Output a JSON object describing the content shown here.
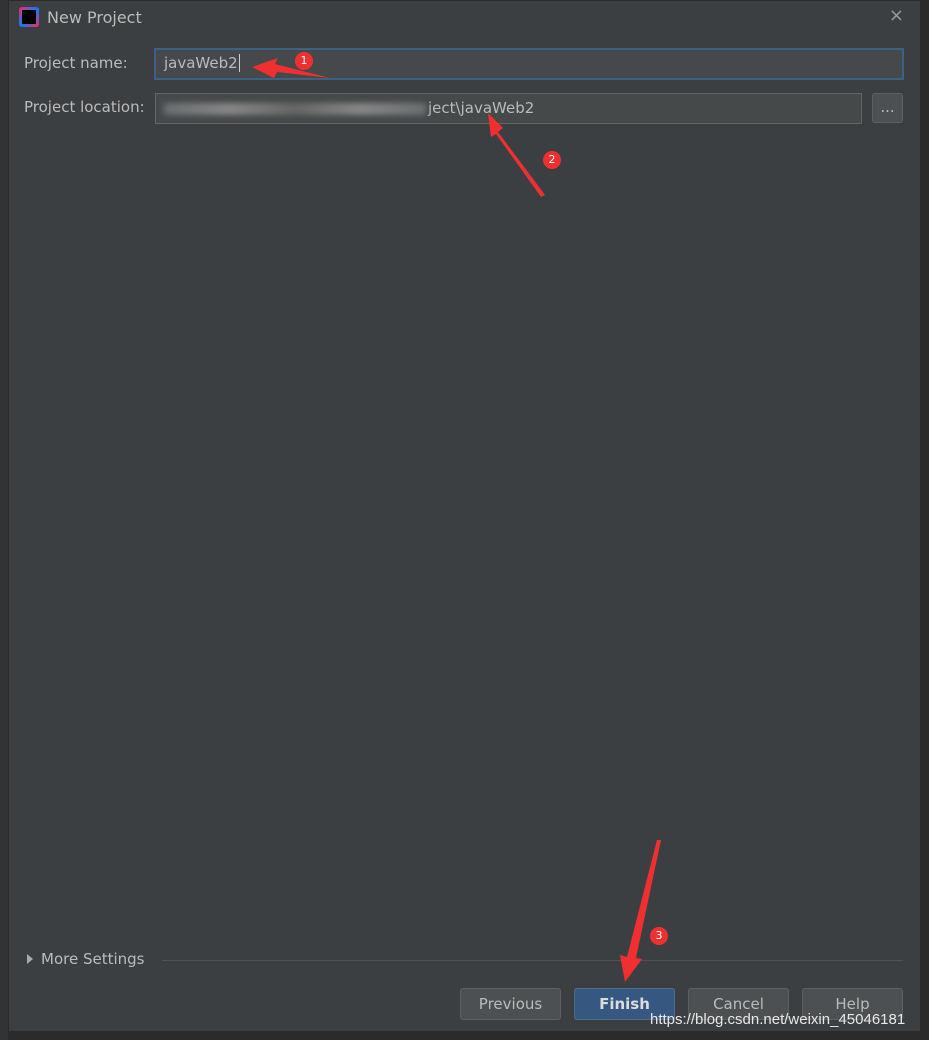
{
  "dialog": {
    "title": "New Project",
    "close_icon": "×",
    "project_name_label": "Project name:",
    "project_name_value": "javaWeb2",
    "project_location_label": "Project location:",
    "project_location_value": "ject\\javaWeb2",
    "browse_label": "...",
    "more_settings_label": "More Settings",
    "buttons": {
      "previous": "Previous",
      "finish": "Finish",
      "cancel": "Cancel",
      "help": "Help"
    }
  },
  "annotations": [
    "1",
    "2",
    "3"
  ],
  "annotation_color": "#f03030",
  "watermark": "https://blog.csdn.net/weixin_45046181"
}
